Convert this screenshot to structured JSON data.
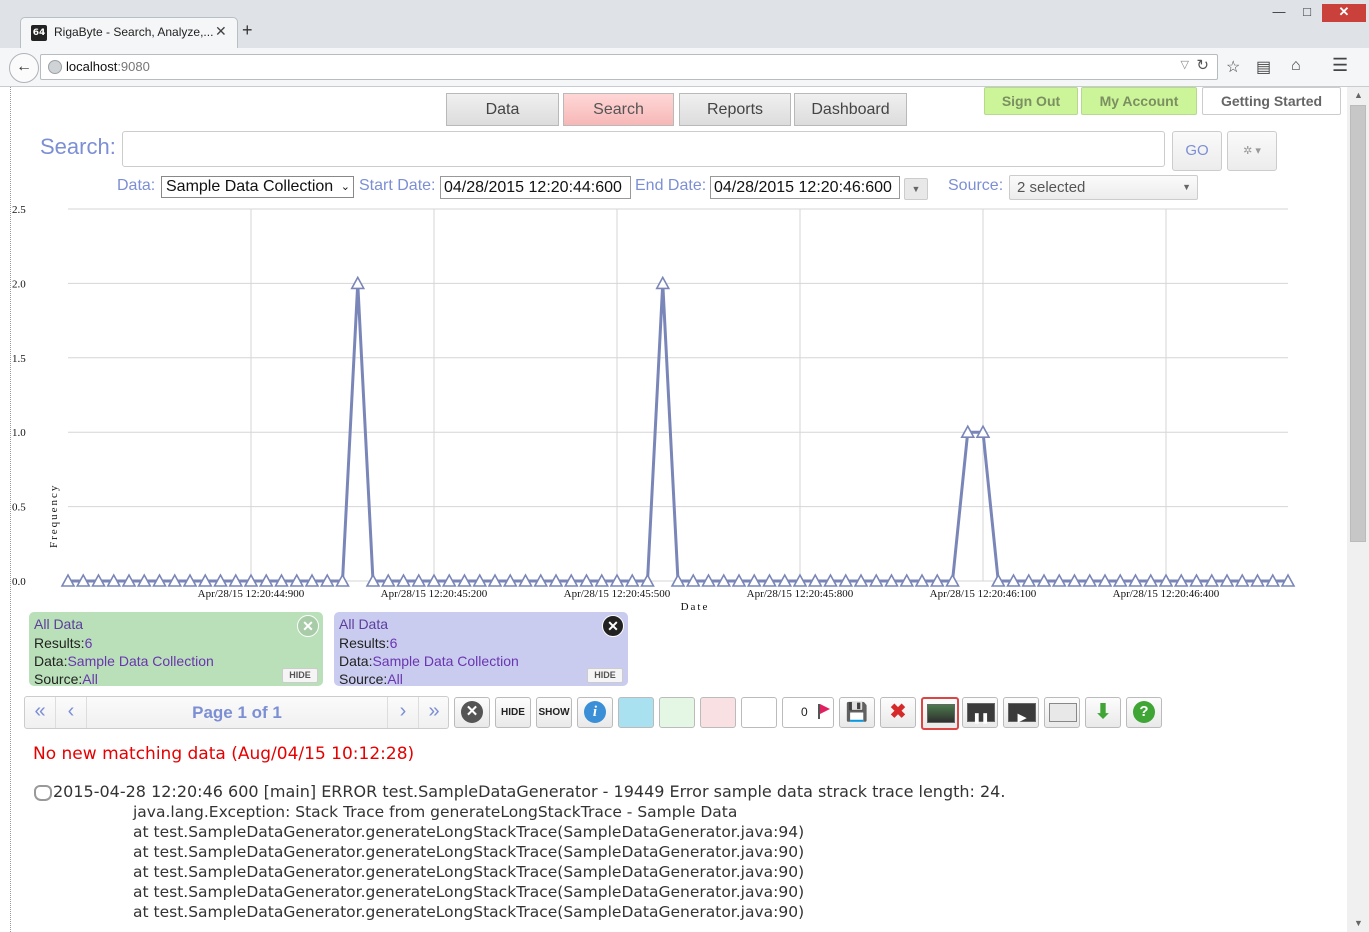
{
  "browser": {
    "tab_title": "RigaByte - Search, Analyze,...",
    "favicon_text": "64",
    "url_host": "localhost",
    "url_port": ":9080"
  },
  "nav": {
    "tabs": [
      "Data",
      "Search",
      "Reports",
      "Dashboard"
    ],
    "active_tab": "Search",
    "signout": "Sign Out",
    "my_account": "My Account",
    "getting_started": "Getting Started"
  },
  "search": {
    "label": "Search:",
    "query": "",
    "go": "GO",
    "data_label": "Data:",
    "data_value": "Sample Data Collection",
    "start_label": "Start Date:",
    "start_value": "04/28/2015 12:20:44:600",
    "end_label": "End Date:",
    "end_value": "04/28/2015 12:20:46:600",
    "source_label": "Source:",
    "source_value": "2 selected"
  },
  "chart_data": {
    "type": "line",
    "xlabel": "Date",
    "ylabel": "Frequency",
    "ylim": [
      0,
      2.5
    ],
    "yticks": [
      "0.0",
      "0.5",
      "1.0",
      "1.5",
      "2.0",
      "2.5"
    ],
    "xticks": [
      "Apr/28/15 12:20:44:900",
      "Apr/28/15 12:20:45:200",
      "Apr/28/15 12:20:45:500",
      "Apr/28/15 12:20:45:800",
      "Apr/28/15 12:20:46:100",
      "Apr/28/15 12:20:46:400"
    ],
    "xlim_ms": [
      44600,
      46600
    ],
    "bin_ms": 25,
    "grid": true,
    "color": "#7a86b8",
    "series": [
      {
        "values": [
          0,
          0,
          0,
          0,
          0,
          0,
          0,
          0,
          0,
          0,
          0,
          0,
          0,
          0,
          0,
          0,
          0,
          0,
          0,
          2,
          0,
          0,
          0,
          0,
          0,
          0,
          0,
          0,
          0,
          0,
          0,
          0,
          0,
          0,
          0,
          0,
          0,
          0,
          0,
          2,
          0,
          0,
          0,
          0,
          0,
          0,
          0,
          0,
          0,
          0,
          0,
          0,
          0,
          0,
          0,
          0,
          0,
          0,
          0,
          1,
          1,
          0,
          0,
          0,
          0,
          0,
          0,
          0,
          0,
          0,
          0,
          0,
          0,
          0,
          0,
          0,
          0,
          0,
          0,
          0,
          0
        ]
      }
    ]
  },
  "cards": [
    {
      "title": "All Data",
      "results_label": "Results:",
      "results": "6",
      "data_label": "Data:",
      "data": "Sample Data Collection",
      "source_label": "Source:",
      "source": "All",
      "hide": "HIDE"
    },
    {
      "title": "All Data",
      "results_label": "Results:",
      "results": "6",
      "data_label": "Data:",
      "data": "Sample Data Collection",
      "source_label": "Source:",
      "source": "All",
      "hide": "HIDE"
    }
  ],
  "toolbar": {
    "first": "«",
    "prev": "‹",
    "next": "›",
    "last": "»",
    "page_info": "Page 1 of 1",
    "hide": "HIDE",
    "show": "SHOW",
    "flag_count": "0"
  },
  "status": "No new matching data (Aug/04/15 10:12:28)",
  "log": {
    "header": "2015-04-28 12:20:46 600 [main] ERROR test.SampleDataGenerator - 19449 Error sample data strack trace length: 24.",
    "lines": [
      "java.lang.Exception: Stack Trace from generateLongStackTrace - Sample Data",
      "at test.SampleDataGenerator.generateLongStackTrace(SampleDataGenerator.java:94)",
      "at test.SampleDataGenerator.generateLongStackTrace(SampleDataGenerator.java:90)",
      "at test.SampleDataGenerator.generateLongStackTrace(SampleDataGenerator.java:90)",
      "at test.SampleDataGenerator.generateLongStackTrace(SampleDataGenerator.java:90)",
      "at test.SampleDataGenerator.generateLongStackTrace(SampleDataGenerator.java:90)"
    ]
  }
}
